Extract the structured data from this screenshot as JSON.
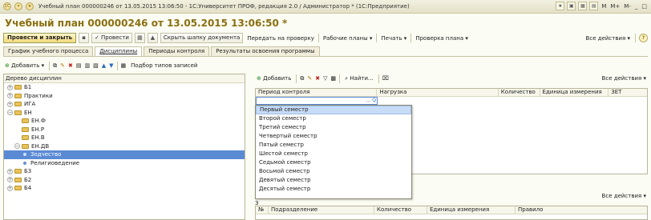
{
  "titlebar": {
    "logo": "1С",
    "title": "Учебный план 000000246 от 13.05.2015 13:06:50 - 1С:Университет ПРОФ, редакция 2.0 / Администратор *  (1С:Предприятие)",
    "controls": [
      "M",
      "M+",
      "M-",
      "_",
      "□"
    ]
  },
  "document": {
    "title": "Учебный план 000000246 от 13.05.2015 13:06:50 *"
  },
  "commandbar": {
    "post_and_close": "Провести и закрыть",
    "post": "Провести",
    "hide_header": "Скрыть шапку документа",
    "send_for_review": "Передать на проверку",
    "work_plans": "Рабочие планы",
    "print": "Печать",
    "check_plan": "Проверка плана",
    "all_actions": "Все действия",
    "help": "?"
  },
  "tabs": [
    {
      "label": "График учебного процесса",
      "active": false
    },
    {
      "label": "Дисциплины",
      "active": true
    },
    {
      "label": "Периоды контроля",
      "active": false
    },
    {
      "label": "Результаты освоения программы",
      "active": false
    }
  ],
  "left_toolbar": {
    "add": "Добавить",
    "pick_records": "Подбор типов записей"
  },
  "tree": {
    "header": "Дерево дисциплин",
    "rows": [
      {
        "label": "Б1",
        "level": 0,
        "kind": "folder",
        "expander": "+"
      },
      {
        "label": "Практики",
        "level": 0,
        "kind": "folder",
        "expander": "+"
      },
      {
        "label": "ИГА",
        "level": 0,
        "kind": "folder",
        "expander": "+"
      },
      {
        "label": "ЕН",
        "level": 0,
        "kind": "folder",
        "expander": "−"
      },
      {
        "label": "ЕН.Ф",
        "level": 1,
        "kind": "folder",
        "expander": ""
      },
      {
        "label": "ЕН.Р",
        "level": 1,
        "kind": "folder",
        "expander": ""
      },
      {
        "label": "ЕН.В",
        "level": 1,
        "kind": "folder",
        "expander": ""
      },
      {
        "label": "ЕН.ДВ",
        "level": 1,
        "kind": "folder",
        "expander": "−"
      },
      {
        "label": "Зодчество",
        "level": 2,
        "kind": "leaf",
        "expander": "",
        "selected": true
      },
      {
        "label": "Религиоведение",
        "level": 2,
        "kind": "leaf",
        "expander": ""
      },
      {
        "label": "Б3",
        "level": 0,
        "kind": "folder",
        "expander": "+"
      },
      {
        "label": "Б2",
        "level": 0,
        "kind": "folder",
        "expander": "+"
      },
      {
        "label": "Б4",
        "level": 0,
        "kind": "folder",
        "expander": "+"
      }
    ]
  },
  "right_toolbar": {
    "add": "Добавить",
    "find": "Найти...",
    "all_actions": "Все действия"
  },
  "grid": {
    "columns": [
      "Период контроля",
      "Нагрузка",
      "Количество",
      "Единица измерения",
      "ЗЕТ"
    ],
    "edit_value": "",
    "edit_buttons": [
      "...",
      "Q"
    ]
  },
  "dropdown": {
    "items": [
      "Первый семестр",
      "Второй семестр",
      "Третий семестр",
      "Четвертый семестр",
      "Пятый семестр",
      "Шестой семестр",
      "Седьмой семестр",
      "Восьмой семестр",
      "Девятый семестр",
      "Десятый семестр"
    ],
    "highlighted_index": 0
  },
  "bottom": {
    "label": "З",
    "all_actions": "Все действия",
    "columns": [
      "№",
      "Подразделение",
      "Количество",
      "Единица измерения",
      "Правило"
    ]
  }
}
